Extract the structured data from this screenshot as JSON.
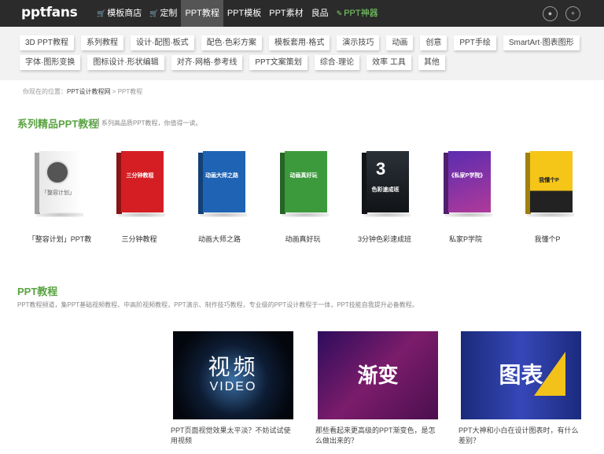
{
  "logo": "pptfans",
  "nav": [
    {
      "label": "模板商店",
      "icon": "cart-icon"
    },
    {
      "label": "定制",
      "icon": "cart-icon"
    },
    {
      "label": "PPT教程",
      "active": true
    },
    {
      "label": "PPT模板"
    },
    {
      "label": "PPT素材"
    },
    {
      "label": "良品"
    },
    {
      "label": "PPT神器",
      "icon": "pencil-icon",
      "accent": "#7fd96b"
    }
  ],
  "user_icons": [
    "user-icon",
    "add-user-icon"
  ],
  "categories_row1": [
    "3D PPT教程",
    "系列教程",
    "设计·配图·板式",
    "配色·色彩方案",
    "模板套用·格式",
    "演示技巧",
    "动画",
    "创意",
    "PPT手绘",
    "SmartArt·图表图形"
  ],
  "categories_row2": [
    "字体·图形变换",
    "图标设计·形状编辑",
    "对齐·网格·参考线",
    "PPT文案策划",
    "综合·理论",
    "效率 工具",
    "其他"
  ],
  "breadcrumb": {
    "prefix": "你现在的位置：",
    "home": "PPT设计教程网",
    "sep": " > ",
    "current": "PPT教程"
  },
  "series": {
    "title": "系列精品PPT教程",
    "subtitle": "系列高品质PPT教程，你值得一读。",
    "books": [
      {
        "label": "「整容计划」PPT教",
        "color": "#f4f4f4",
        "cover": "「整容计划」"
      },
      {
        "label": "三分钟教程",
        "color": "#d41e24",
        "cover": "三分钟教程"
      },
      {
        "label": "动画大师之路",
        "color": "#1e63b4",
        "cover": "动画大师之路"
      },
      {
        "label": "动画真好玩",
        "color": "#3c9a3c",
        "cover": "动画真好玩"
      },
      {
        "label": "3分钟色彩速成班",
        "color": "#1b1f24",
        "cover": "色彩速成班"
      },
      {
        "label": "私家P学院",
        "color": "#7b2fa8",
        "cover": "《私家P学院》"
      },
      {
        "label": "我懂个P",
        "color": "#f5c518",
        "cover": "我懂个P"
      }
    ]
  },
  "tutorials": {
    "title": "PPT教程",
    "desc": "PPT教程频道，集PPT基础视频教程、中高阶视频教程，PPT演示、制作技巧教程，专业级的PPT设计教程于一体，PPT技能自我提升必备教程。",
    "articles": [
      {
        "thumb_text": "视频",
        "thumb_sub": "VIDEO",
        "title": "PPT页面视觉效果太平淡？不妨试试使用视频"
      },
      {
        "thumb_text": "渐变",
        "title": "那些看起来更高级的PPT渐变色，是怎么做出来的？"
      },
      {
        "thumb_text": "图表",
        "title": "PPT大神和小白在设计图表时，有什么差别？"
      }
    ]
  }
}
